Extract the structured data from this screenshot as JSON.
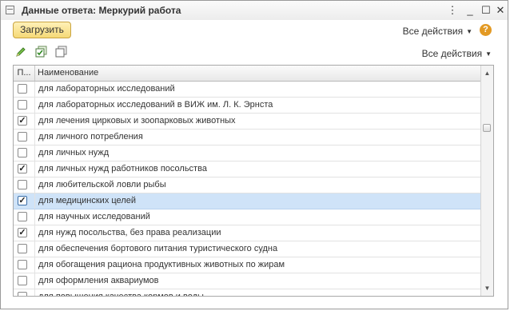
{
  "window": {
    "title": "Данные ответа: Меркурий работа"
  },
  "window_controls": {
    "menu": "⋮",
    "minimize": "_",
    "maximize": "☐",
    "close": "✕"
  },
  "toolbar": {
    "load_label": "Загрузить",
    "all_actions_label": "Все действия",
    "help_label": "?"
  },
  "table_toolbar": {
    "edit_icon": "pencil-icon",
    "check_all_icon": "check-all-icon",
    "uncheck_all_icon": "uncheck-all-icon",
    "all_actions_label": "Все действия"
  },
  "table": {
    "columns": [
      "П...",
      "Наименование"
    ],
    "rows": [
      {
        "checked": false,
        "selected": false,
        "name": "для лабораторных исследований"
      },
      {
        "checked": false,
        "selected": false,
        "name": "для лабораторных исследований в ВИЖ им. Л. К. Эрнста"
      },
      {
        "checked": true,
        "selected": false,
        "name": "для лечения цирковых и зоопарковых животных"
      },
      {
        "checked": false,
        "selected": false,
        "name": "для личного потребления"
      },
      {
        "checked": false,
        "selected": false,
        "name": "для личных нужд"
      },
      {
        "checked": true,
        "selected": false,
        "name": "для личных нужд работников посольства"
      },
      {
        "checked": false,
        "selected": false,
        "name": "для любительской ловли рыбы"
      },
      {
        "checked": true,
        "selected": true,
        "name": "для медицинских целей"
      },
      {
        "checked": false,
        "selected": false,
        "name": "для научных исследований"
      },
      {
        "checked": true,
        "selected": false,
        "name": "для нужд посольства, без права реализации"
      },
      {
        "checked": false,
        "selected": false,
        "name": "для обеспечения бортового питания туристического судна"
      },
      {
        "checked": false,
        "selected": false,
        "name": "для обогащения рациона продуктивных животных по жирам"
      },
      {
        "checked": false,
        "selected": false,
        "name": "для оформления аквариумов"
      },
      {
        "checked": false,
        "selected": false,
        "name": "для повышения качества кормов и воды"
      }
    ]
  }
}
